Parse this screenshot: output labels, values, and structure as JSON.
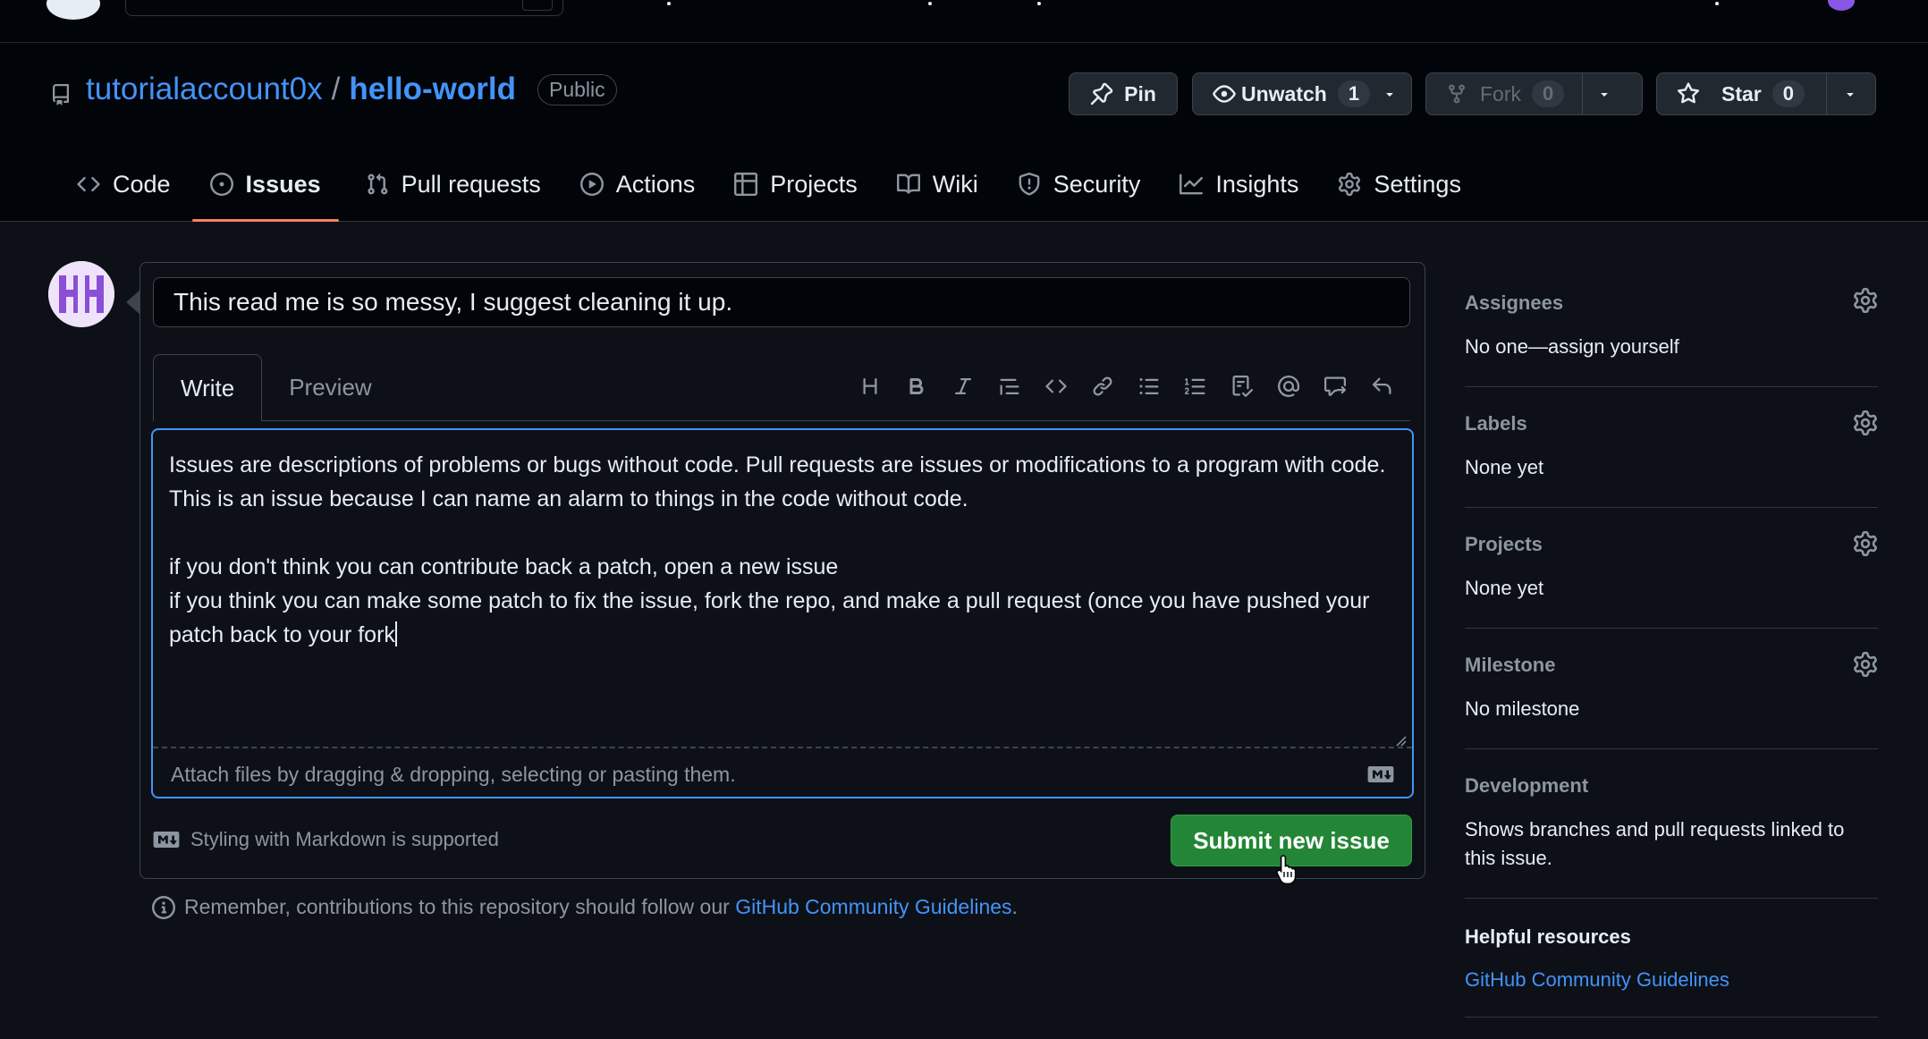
{
  "repo": {
    "owner": "tutorialaccount0x",
    "separator": "/",
    "name": "hello-world",
    "visibility": "Public"
  },
  "actions": {
    "pin": "Pin",
    "watch": "Unwatch",
    "watch_count": "1",
    "fork": "Fork",
    "fork_count": "0",
    "star": "Star",
    "star_count": "0"
  },
  "tabs": [
    {
      "label": "Code",
      "icon": "code-icon"
    },
    {
      "label": "Issues",
      "icon": "issue-icon",
      "active": true
    },
    {
      "label": "Pull requests",
      "icon": "pull-request-icon"
    },
    {
      "label": "Actions",
      "icon": "play-icon"
    },
    {
      "label": "Projects",
      "icon": "table-icon"
    },
    {
      "label": "Wiki",
      "icon": "book-icon"
    },
    {
      "label": "Security",
      "icon": "shield-icon"
    },
    {
      "label": "Insights",
      "icon": "graph-icon"
    },
    {
      "label": "Settings",
      "icon": "gear-icon"
    }
  ],
  "issue": {
    "title": "This read me is so messy, I suggest cleaning it up.",
    "write_tab": "Write",
    "preview_tab": "Preview",
    "body": "Issues are descriptions of problems or bugs without code. Pull requests are issues or modifications to a program with code. This is an issue because I can name an alarm to things in the code without code.\n\nif you don't think you can contribute back a patch, open a new issue\nif you think you can make some patch to fix the issue, fork the repo, and make a pull request (once you have pushed your patch back to your fork",
    "attach_hint": "Attach files by dragging & dropping, selecting or pasting them.",
    "markdown_note": "Styling with Markdown is supported",
    "submit": "Submit new issue",
    "remember_text": "Remember, contributions to this repository should follow our",
    "remember_link": "GitHub Community Guidelines",
    "remember_end": "."
  },
  "toolbar": [
    "heading-icon",
    "bold-icon",
    "italic-icon",
    "quote-icon",
    "code-icon",
    "link-icon",
    "unordered-list-icon",
    "ordered-list-icon",
    "task-list-icon",
    "mention-icon",
    "reference-icon",
    "undo-icon"
  ],
  "sidebar": {
    "assignees": {
      "heading": "Assignees",
      "value_prefix": "No one—",
      "value_link": "assign yourself"
    },
    "labels": {
      "heading": "Labels",
      "value": "None yet"
    },
    "projects": {
      "heading": "Projects",
      "value": "None yet"
    },
    "milestone": {
      "heading": "Milestone",
      "value": "No milestone"
    },
    "development": {
      "heading": "Development",
      "value": "Shows branches and pull requests linked to this issue."
    },
    "helpful": {
      "heading": "Helpful resources",
      "link": "GitHub Community Guidelines"
    }
  },
  "colors": {
    "background": "#0d1117",
    "link": "#4493f8",
    "submit": "#238636",
    "active_tab_underline": "#f78166",
    "editor_focus": "#4493f8"
  }
}
